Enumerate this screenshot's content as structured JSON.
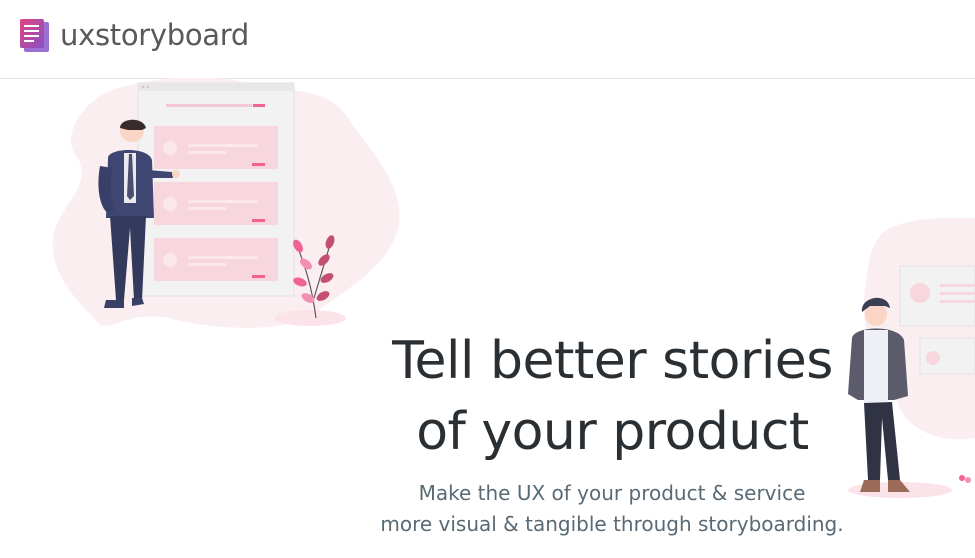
{
  "header": {
    "logo_text": "uxstoryboard",
    "logo_icon": "document-stack-icon"
  },
  "hero": {
    "title_line1": "Tell better stories",
    "title_line2": "of your product",
    "subtitle_line1": "Make the UX of your product & service",
    "subtitle_line2": "more visual & tangible through storyboarding."
  },
  "colors": {
    "brand_pink": "#d9487a",
    "brand_purple": "#7d4fc2",
    "accent_pink": "#f06292",
    "blob_pink": "#fbeef1",
    "navy": "#38406a"
  }
}
